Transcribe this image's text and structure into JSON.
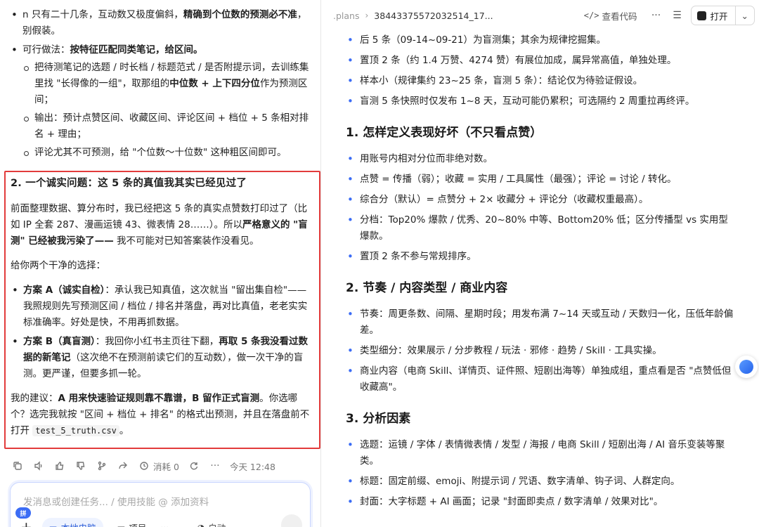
{
  "left": {
    "bullets": [
      {
        "parts": [
          {
            "t": "n 只有二十几条，互动数又极度偏斜，"
          },
          {
            "t": "精确到个位数的预测必不准",
            "b": true
          },
          {
            "t": "，别假装。"
          }
        ]
      },
      {
        "parts": [
          {
            "t": "可行做法："
          },
          {
            "t": "按特征匹配同类笔记，给区间。",
            "b": true
          }
        ],
        "sub": [
          {
            "parts": [
              {
                "t": "把待测笔记的选题 / 时长档 / 标题范式 / 是否附提示词，去训练集里找 \"长得像的一组\"，取那组的"
              },
              {
                "t": "中位数 + 上下四分位",
                "b": true
              },
              {
                "t": "作为预测区间；"
              }
            ]
          },
          {
            "parts": [
              {
                "t": "输出：预计点赞区间、收藏区间、评论区间 + 档位 + 5 条相对排名 + 理由；"
              }
            ]
          },
          {
            "parts": [
              {
                "t": "评论尤其不可预测，给 \"个位数～十位数\" 这种粗区间即可。"
              }
            ]
          }
        ]
      }
    ],
    "highlight": {
      "heading": "2. 一个诚实问题：这 5 条的真值我其实已经见过了",
      "p1": [
        {
          "t": "前面整理数据、算分布时，我已经把这 5 条的真实点赞数打印过了（比如 IP 全套 287、漫画运镜 43、微表情 28……）。所以"
        },
        {
          "t": "严格意义的 \"盲测\" 已经被我污染了——",
          "b": true
        },
        {
          "t": " 我不可能对已知答案装作没看见。"
        }
      ],
      "p2": "给你两个干净的选择：",
      "options": [
        [
          {
            "t": "方案 A（诚实自检）",
            "b": true
          },
          {
            "t": "：承认我已知真值，这次就当 \"留出集自检\"—— 我照规则先写预测区间 / 档位 / 排名并落盘，再对比真值，老老实实标准确率。好处是快，不用再抓数据。"
          }
        ],
        [
          {
            "t": "方案 B（真盲测）",
            "b": true
          },
          {
            "t": "：我回你小红书主页往下翻，"
          },
          {
            "t": "再取 5 条我没看过数据的新笔记",
            "b": true
          },
          {
            "t": "（这次绝不在预测前读它们的互动数），做一次干净的盲测。更严谨，但要多抓一轮。"
          }
        ]
      ],
      "p3": [
        {
          "t": "我的建议："
        },
        {
          "t": "A 用来快速验证规则靠不靠谱，B 留作正式盲测",
          "b": true
        },
        {
          "t": "。你选哪个？选完我就按 \"区间 + 档位 + 排名\" 的格式出预测，并且在落盘前不打开 "
        },
        {
          "t": "test_5_truth.csv",
          "code": true
        },
        {
          "t": "。"
        }
      ]
    },
    "actions": {
      "credit_label": "消耗 0",
      "time": "今天 12:48"
    },
    "composer": {
      "placeholder": "发消息或创建任务... / 使用技能 @ 添加资料",
      "badge": "拼",
      "pill1": "本地电脑",
      "pill2": "项目",
      "mode": "自动"
    }
  },
  "right": {
    "breadcrumb": [
      ".plans",
      "3844337557203251​4_17..."
    ],
    "view_code": "查看代码",
    "open_label": "打开",
    "intro": [
      "后 5 条（09-14~09-21）为盲测集；其余为规律挖掘集。",
      "置顶 2 条（约 1.4 万赞、4274 赞）有展位加成，属异常高值，单独处理。",
      "样本小（规律集约 23~25 条，盲测 5 条）：结论仅为待验证假设。",
      "盲测 5 条快照时仅发布 1~8 天，互动可能仍累积；可选隔约 2 周重拉再终评。"
    ],
    "sections": [
      {
        "title": "1. 怎样定义表现好坏（不只看点赞）",
        "items": [
          "用账号内相对分位而非绝对数。",
          "点赞 = 传播（弱）；收藏 = 实用 / 工具属性（最强）；评论 = 讨论 / 转化。",
          "综合分（默认）= 点赞分 + 2× 收藏分 + 评论分（收藏权重最高）。",
          "分档：Top20% 爆款 / 优秀、20~80% 中等、Bottom20% 低；区分传播型 vs 实用型爆款。",
          "置顶 2 条不参与常规排序。"
        ]
      },
      {
        "title": "2. 节奏 / 内容类型 / 商业内容",
        "items": [
          "节奏：周更条数、间隔、星期时段；用发布满 7~14 天或互动 / 天数归一化，压低年龄偏差。",
          "类型细分：效果展示 / 分步教程 / 玩法 · 邪修 · 趋势 / Skill · 工具实操。",
          "商业内容（电商 Skill、详情页、证件照、短剧出海等）单独成组，重点看是否 \"点赞低但收藏高\"。"
        ]
      },
      {
        "title": "3. 分析因素",
        "items": [
          "选题：运镜 / 字体 / 表情微表情 / 发型 / 海报 / 电商 Skill / 短剧出海 / AI 音乐变装等聚类。",
          "标题：固定前缀、emoji、附提示词 / 咒语、数字清单、钩子词、人群定向。",
          "封面：大字标题 + AI 画面；记录 \"封面即卖点 / 数字清单 / 效果对比\"。"
        ]
      }
    ]
  }
}
